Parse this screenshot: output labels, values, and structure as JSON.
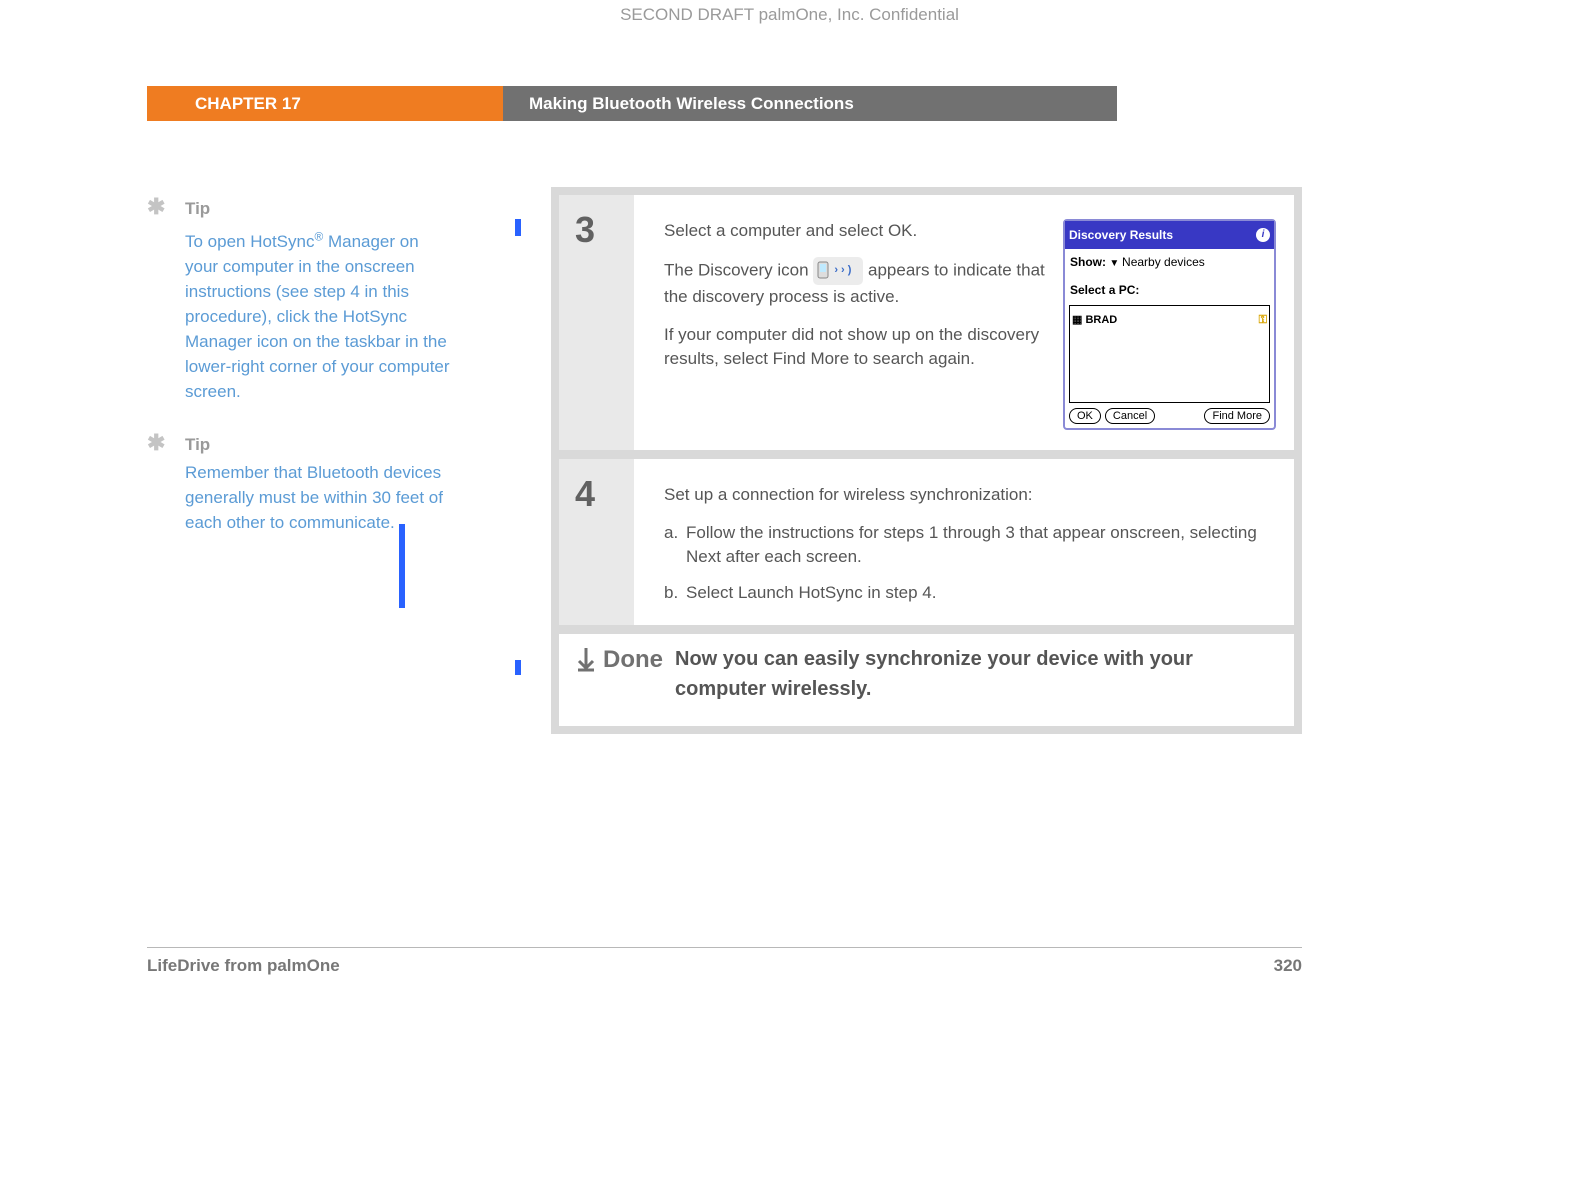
{
  "header": {
    "confidential": "SECOND DRAFT palmOne, Inc.  Confidential",
    "chapter": "CHAPTER 17",
    "title": "Making Bluetooth Wireless Connections"
  },
  "tips": [
    {
      "heading": "Tip",
      "pre": "To open HotSync",
      "sup": "®",
      "post": " Manager on your computer in the onscreen instructions (see step 4 in this procedure), click the HotSync Manager icon on the taskbar in the lower-right corner of your computer screen."
    },
    {
      "heading": "Tip",
      "text": "Remember that Bluetooth devices generally must be within 30 feet of each other to communicate."
    }
  ],
  "steps": {
    "s3": {
      "num": "3",
      "p1": "Select a computer and select OK.",
      "p2a": "The Discovery icon ",
      "p2b": " appears to indicate that the discovery process is active.",
      "p3": "If your computer did not show up on the discovery results, select Find More to search again."
    },
    "s4": {
      "num": "4",
      "intro": "Set up a connection for wireless synchronization:",
      "a_lbl": "a.",
      "a": "Follow the instructions for steps 1 through 3 that appear onscreen, selecting Next after each screen.",
      "b_lbl": "b.",
      "b": "Select Launch HotSync in step 4."
    },
    "done": {
      "label": "Done",
      "text": "Now you can easily synchronize your device with your computer wirelessly."
    }
  },
  "dialog": {
    "title": "Discovery Results",
    "show_label": "Show:",
    "show_value": "Nearby devices",
    "select_label": "Select a PC:",
    "item": "BRAD",
    "ok": "OK",
    "cancel": "Cancel",
    "find": "Find More"
  },
  "footer": {
    "product": "LifeDrive from palmOne",
    "page": "320"
  }
}
